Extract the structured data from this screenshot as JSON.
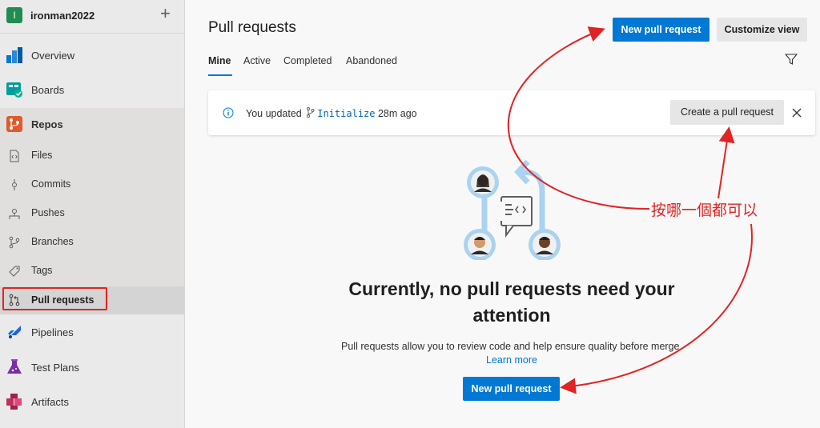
{
  "project": {
    "initial": "I",
    "name": "ironman2022",
    "add": "+"
  },
  "nav": {
    "overview": "Overview",
    "boards": "Boards",
    "repos": "Repos",
    "files": "Files",
    "commits": "Commits",
    "pushes": "Pushes",
    "branches": "Branches",
    "tags": "Tags",
    "pull_requests": "Pull requests",
    "pipelines": "Pipelines",
    "test_plans": "Test Plans",
    "artifacts": "Artifacts"
  },
  "header": {
    "title": "Pull requests",
    "new_pr": "New pull request",
    "customize": "Customize view"
  },
  "tabs": [
    "Mine",
    "Active",
    "Completed",
    "Abandoned"
  ],
  "banner": {
    "prefix": "You updated",
    "branch": "Initialize",
    "suffix": "28m ago",
    "create_pr": "Create a pull request"
  },
  "empty_state": {
    "title": "Currently, no pull requests need your attention",
    "desc": "Pull requests allow you to review code and help ensure quality before merge.",
    "learn_more": "Learn more",
    "button": "New pull request"
  },
  "annotation": "按哪一個都可以",
  "colors": {
    "accent": "#0078d4",
    "annotation": "#e02424",
    "selected_nav": "#d4d4d4"
  },
  "icons": [
    "overview-icon",
    "boards-icon",
    "repos-icon",
    "files-icon",
    "commits-icon",
    "pushes-icon",
    "branches-icon",
    "tags-icon",
    "pull-request-icon",
    "pipelines-icon",
    "test-plans-icon",
    "artifacts-icon",
    "filter-icon",
    "info-icon",
    "branch-icon",
    "close-icon"
  ]
}
